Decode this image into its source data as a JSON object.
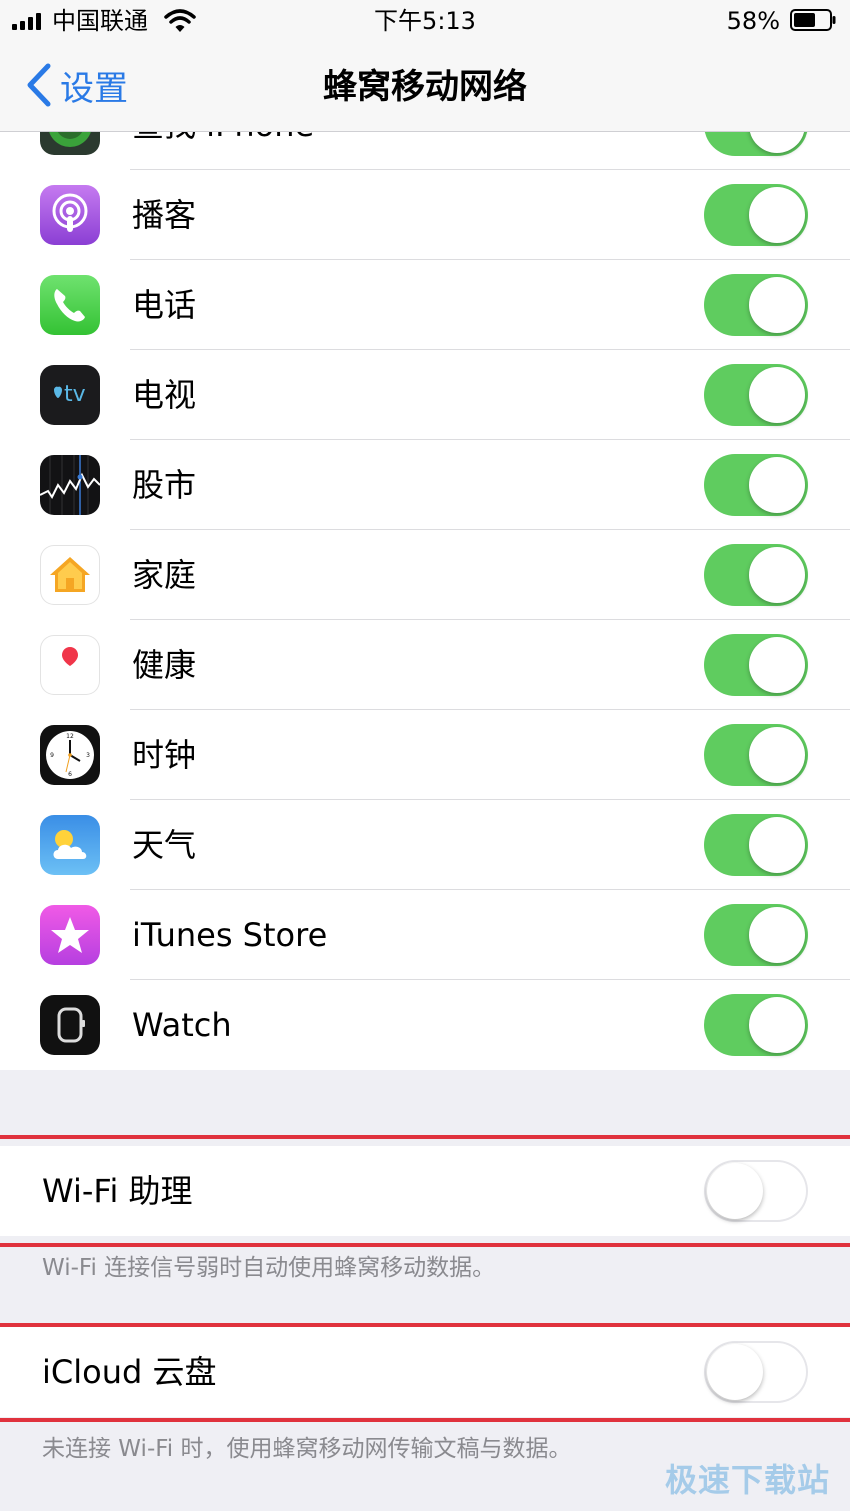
{
  "status_bar": {
    "carrier": "中国联通",
    "time": "下午5:13",
    "battery": "58%"
  },
  "nav": {
    "back_label": "设置",
    "title": "蜂窝移动网络"
  },
  "apps": [
    {
      "label": "查找 iPhone",
      "icon": "find-iphone-icon",
      "on": true
    },
    {
      "label": "播客",
      "icon": "podcasts-icon",
      "on": true
    },
    {
      "label": "电话",
      "icon": "phone-icon",
      "on": true
    },
    {
      "label": "电视",
      "icon": "apple-tv-icon",
      "on": true,
      "icon_text": "tv"
    },
    {
      "label": "股市",
      "icon": "stocks-icon",
      "on": true
    },
    {
      "label": "家庭",
      "icon": "home-icon",
      "on": true
    },
    {
      "label": "健康",
      "icon": "health-icon",
      "on": true
    },
    {
      "label": "时钟",
      "icon": "clock-icon",
      "on": true
    },
    {
      "label": "天气",
      "icon": "weather-icon",
      "on": true
    },
    {
      "label": "iTunes Store",
      "icon": "itunes-store-icon",
      "on": true
    },
    {
      "label": "Watch",
      "icon": "watch-icon",
      "on": true
    }
  ],
  "wifi_assist": {
    "label": "Wi-Fi 助理",
    "on": false,
    "footnote": "Wi-Fi 连接信号弱时自动使用蜂窝移动数据。"
  },
  "icloud_drive": {
    "label": "iCloud 云盘",
    "on": false,
    "footnote": "未连接 Wi-Fi 时，使用蜂窝移动网传输文稿与数据。"
  },
  "watermark": "极速下载站",
  "colors": {
    "toggle_on": "#5fcc5f",
    "accent": "#2a7ae6",
    "highlight": "#e0323d"
  }
}
